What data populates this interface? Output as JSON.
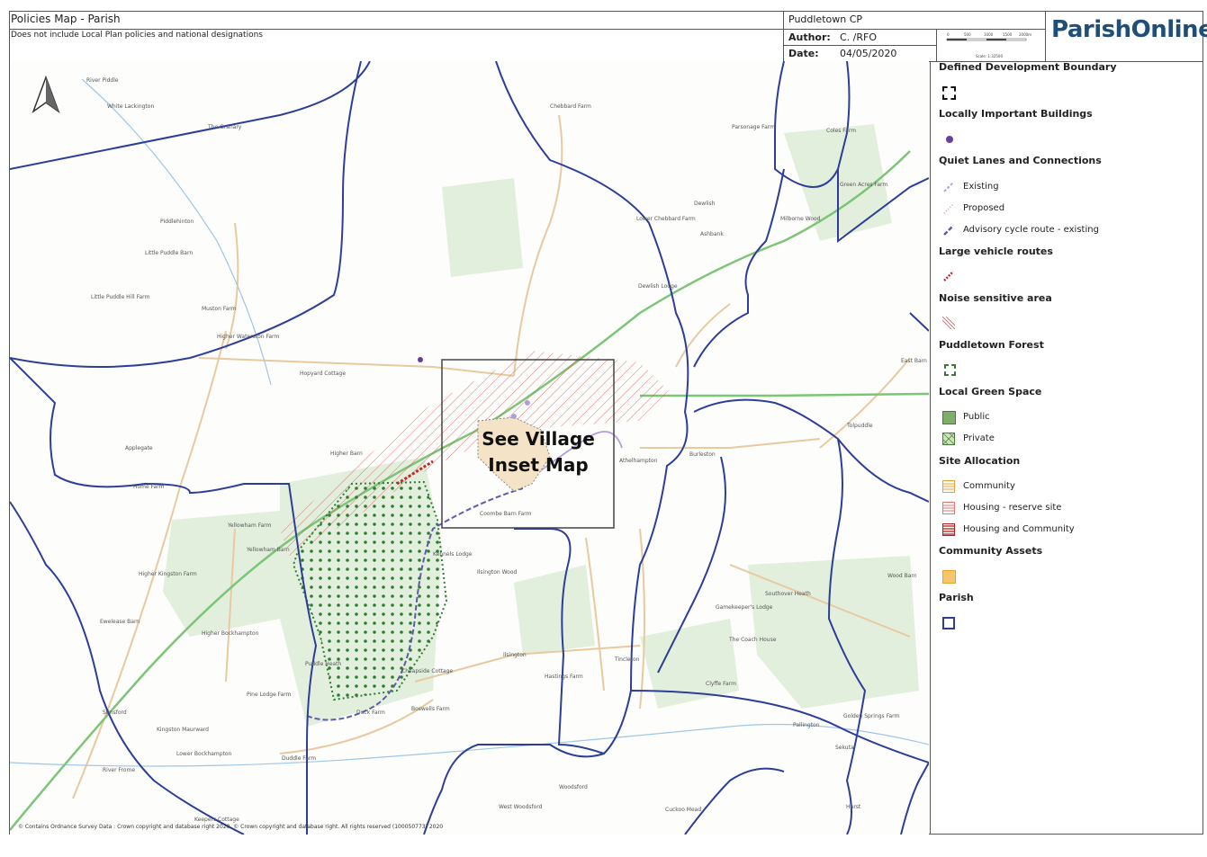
{
  "header": {
    "title": "Policies Map - Parish",
    "subtitle": "Does not include Local Plan policies and national designations",
    "parish_name": "Puddletown CP",
    "author_label": "Author:",
    "author_value": "C. /RFO",
    "date_label": "Date:",
    "date_value": "04/05/2020",
    "scale_text": "Scale: 1:32500",
    "scale_ticks": [
      "0",
      "500",
      "1000",
      "1500",
      "2000m"
    ]
  },
  "logo": {
    "part1": "Parish",
    "part2": "Online"
  },
  "inset_label": {
    "line1": "See Village",
    "line2": "Inset Map"
  },
  "copyright": "© Contains Ordnance Survey Data : Crown copyright and database right 2020, © Crown copyright and database right. All rights reserved (100050773) 2020",
  "legend": {
    "ddb_title": "Defined Development Boundary",
    "lib_title": "Locally Important Buildings",
    "quiet_title": "Quiet Lanes and Connections",
    "quiet_existing": "Existing",
    "quiet_proposed": "Proposed",
    "quiet_cycle": "Advisory cycle route - existing",
    "lvr_title": "Large vehicle routes",
    "noise_title": "Noise sensitive area",
    "forest_title": "Puddletown Forest",
    "lgs_title": "Local Green Space",
    "lgs_public": "Public",
    "lgs_private": "Private",
    "site_title": "Site Allocation",
    "site_community": "Community",
    "site_reserve": "Housing - reserve site",
    "site_housing_comm": "Housing and Community",
    "assets_title": "Community Assets",
    "parish_title": "Parish"
  },
  "colors": {
    "parish_boundary": "#2c3e9a",
    "forest": "#2e7d32",
    "green_road": "#7cc576",
    "noise": "#d9534f",
    "quiet_existing": "#8e6fd1",
    "cycle": "#5c5ca8",
    "community": "#f0a030",
    "building": "#6a3d9a"
  },
  "map_labels": {
    "l1": "River Piddle",
    "l2": "White Lackington",
    "l3": "The Granary",
    "l4": "Piddlehinton",
    "l5": "Little Puddle Barn",
    "l6": "Little Puddle Hill Farm",
    "l7": "Muston Farm",
    "l8": "Higher Waterston Farm",
    "l9": "Hopyard Cottage",
    "l10": "Applegate",
    "l11": "Higher Barn",
    "l12": "Home Farm",
    "l13": "Yellowham Farm",
    "l14": "Yellowham Barn",
    "l15": "Higher Kingston Farm",
    "l16": "Ewelease Barn",
    "l17": "Higher Bockhampton",
    "l18": "Pine Lodge Farm",
    "l19": "Stinsford",
    "l20": "Kingston Maurward",
    "l21": "Lower Bockhampton",
    "l22": "River Frome",
    "l23": "Keepers Cottage",
    "l24": "Duddle Farm",
    "l25": "Duck Farm",
    "l26": "Boswells Farm",
    "l27": "Cheapside Cottage",
    "l28": "Ilsington",
    "l29": "Hastings Farm",
    "l30": "Tincleton",
    "l31": "Clyffe Farm",
    "l32": "Woodsford",
    "l33": "West Woodsford",
    "l34": "Cuckoo Mead",
    "l35": "Hurst",
    "l36": "Sekuta",
    "l37": "Pallington",
    "l38": "Golden Springs Farm",
    "l39": "Gamekeeper's Lodge",
    "l40": "The Coach House",
    "l41": "Southover Heath",
    "l42": "Wood Barn",
    "l43": "Tolpuddle",
    "l44": "Burleston",
    "l45": "Athelhampton",
    "l46": "Dewlish Lodge",
    "l47": "Ashbank",
    "l48": "Lower Chebbard Farm",
    "l49": "Chebbard Farm",
    "l50": "Parsonage Farm",
    "l51": "Coles Farm",
    "l52": "Green Acres Farm",
    "l53": "Milborne Wood",
    "l54": "East Barn",
    "l55": "Dewlish",
    "l56": "Coombe Barn Farm",
    "l57": "Ilsington Wood",
    "l58": "Kennels Lodge",
    "l59": "Puddle Heath"
  }
}
